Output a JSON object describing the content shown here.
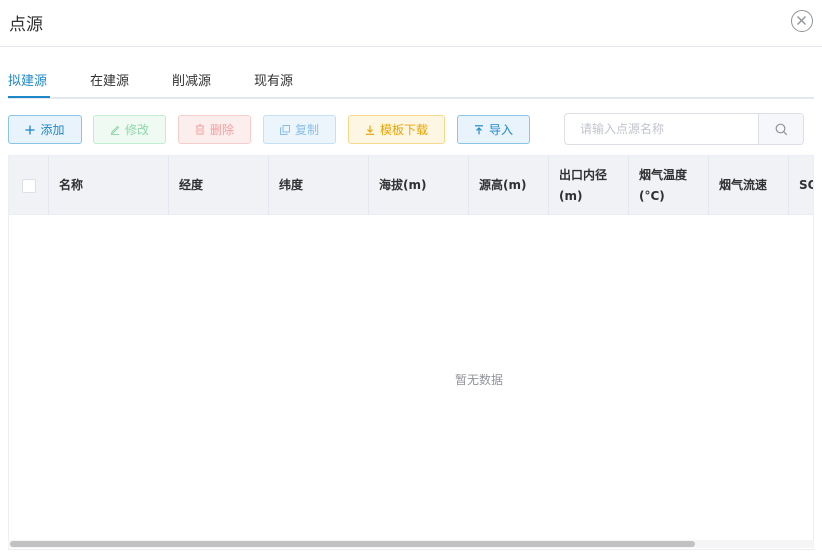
{
  "dialog": {
    "title": "点源"
  },
  "tabs": [
    {
      "label": "拟建源",
      "active": true
    },
    {
      "label": "在建源",
      "active": false
    },
    {
      "label": "削减源",
      "active": false
    },
    {
      "label": "现有源",
      "active": false
    }
  ],
  "toolbar": {
    "add_label": "添加",
    "edit_label": "修改",
    "delete_label": "删除",
    "copy_label": "复制",
    "template_download_label": "模板下载",
    "import_label": "导入"
  },
  "search": {
    "placeholder": "请输入点源名称",
    "value": ""
  },
  "table": {
    "columns": [
      "名称",
      "经度",
      "纬度",
      "海拔(m)",
      "源高(m)",
      "出口内径(m)",
      "烟气温度(°C)",
      "烟气流速",
      "SO"
    ],
    "empty_text": "暂无数据"
  },
  "colors": {
    "accent": "#1e88c8",
    "header_bg": "#f0f2f5"
  }
}
